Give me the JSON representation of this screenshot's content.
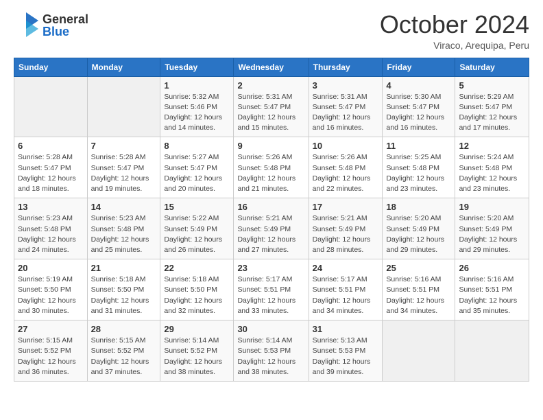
{
  "logo": {
    "general": "General",
    "blue": "Blue"
  },
  "header": {
    "month": "October 2024",
    "location": "Viraco, Arequipa, Peru"
  },
  "days_of_week": [
    "Sunday",
    "Monday",
    "Tuesday",
    "Wednesday",
    "Thursday",
    "Friday",
    "Saturday"
  ],
  "weeks": [
    [
      {
        "day": "",
        "empty": true
      },
      {
        "day": "",
        "empty": true
      },
      {
        "day": "1",
        "sunrise": "5:32 AM",
        "sunset": "5:46 PM",
        "daylight": "12 hours and 14 minutes."
      },
      {
        "day": "2",
        "sunrise": "5:31 AM",
        "sunset": "5:47 PM",
        "daylight": "12 hours and 15 minutes."
      },
      {
        "day": "3",
        "sunrise": "5:31 AM",
        "sunset": "5:47 PM",
        "daylight": "12 hours and 16 minutes."
      },
      {
        "day": "4",
        "sunrise": "5:30 AM",
        "sunset": "5:47 PM",
        "daylight": "12 hours and 16 minutes."
      },
      {
        "day": "5",
        "sunrise": "5:29 AM",
        "sunset": "5:47 PM",
        "daylight": "12 hours and 17 minutes."
      }
    ],
    [
      {
        "day": "6",
        "sunrise": "5:28 AM",
        "sunset": "5:47 PM",
        "daylight": "12 hours and 18 minutes."
      },
      {
        "day": "7",
        "sunrise": "5:28 AM",
        "sunset": "5:47 PM",
        "daylight": "12 hours and 19 minutes."
      },
      {
        "day": "8",
        "sunrise": "5:27 AM",
        "sunset": "5:47 PM",
        "daylight": "12 hours and 20 minutes."
      },
      {
        "day": "9",
        "sunrise": "5:26 AM",
        "sunset": "5:48 PM",
        "daylight": "12 hours and 21 minutes."
      },
      {
        "day": "10",
        "sunrise": "5:26 AM",
        "sunset": "5:48 PM",
        "daylight": "12 hours and 22 minutes."
      },
      {
        "day": "11",
        "sunrise": "5:25 AM",
        "sunset": "5:48 PM",
        "daylight": "12 hours and 23 minutes."
      },
      {
        "day": "12",
        "sunrise": "5:24 AM",
        "sunset": "5:48 PM",
        "daylight": "12 hours and 23 minutes."
      }
    ],
    [
      {
        "day": "13",
        "sunrise": "5:23 AM",
        "sunset": "5:48 PM",
        "daylight": "12 hours and 24 minutes."
      },
      {
        "day": "14",
        "sunrise": "5:23 AM",
        "sunset": "5:48 PM",
        "daylight": "12 hours and 25 minutes."
      },
      {
        "day": "15",
        "sunrise": "5:22 AM",
        "sunset": "5:49 PM",
        "daylight": "12 hours and 26 minutes."
      },
      {
        "day": "16",
        "sunrise": "5:21 AM",
        "sunset": "5:49 PM",
        "daylight": "12 hours and 27 minutes."
      },
      {
        "day": "17",
        "sunrise": "5:21 AM",
        "sunset": "5:49 PM",
        "daylight": "12 hours and 28 minutes."
      },
      {
        "day": "18",
        "sunrise": "5:20 AM",
        "sunset": "5:49 PM",
        "daylight": "12 hours and 29 minutes."
      },
      {
        "day": "19",
        "sunrise": "5:20 AM",
        "sunset": "5:49 PM",
        "daylight": "12 hours and 29 minutes."
      }
    ],
    [
      {
        "day": "20",
        "sunrise": "5:19 AM",
        "sunset": "5:50 PM",
        "daylight": "12 hours and 30 minutes."
      },
      {
        "day": "21",
        "sunrise": "5:18 AM",
        "sunset": "5:50 PM",
        "daylight": "12 hours and 31 minutes."
      },
      {
        "day": "22",
        "sunrise": "5:18 AM",
        "sunset": "5:50 PM",
        "daylight": "12 hours and 32 minutes."
      },
      {
        "day": "23",
        "sunrise": "5:17 AM",
        "sunset": "5:51 PM",
        "daylight": "12 hours and 33 minutes."
      },
      {
        "day": "24",
        "sunrise": "5:17 AM",
        "sunset": "5:51 PM",
        "daylight": "12 hours and 34 minutes."
      },
      {
        "day": "25",
        "sunrise": "5:16 AM",
        "sunset": "5:51 PM",
        "daylight": "12 hours and 34 minutes."
      },
      {
        "day": "26",
        "sunrise": "5:16 AM",
        "sunset": "5:51 PM",
        "daylight": "12 hours and 35 minutes."
      }
    ],
    [
      {
        "day": "27",
        "sunrise": "5:15 AM",
        "sunset": "5:52 PM",
        "daylight": "12 hours and 36 minutes."
      },
      {
        "day": "28",
        "sunrise": "5:15 AM",
        "sunset": "5:52 PM",
        "daylight": "12 hours and 37 minutes."
      },
      {
        "day": "29",
        "sunrise": "5:14 AM",
        "sunset": "5:52 PM",
        "daylight": "12 hours and 38 minutes."
      },
      {
        "day": "30",
        "sunrise": "5:14 AM",
        "sunset": "5:53 PM",
        "daylight": "12 hours and 38 minutes."
      },
      {
        "day": "31",
        "sunrise": "5:13 AM",
        "sunset": "5:53 PM",
        "daylight": "12 hours and 39 minutes."
      },
      {
        "day": "",
        "empty": true
      },
      {
        "day": "",
        "empty": true
      }
    ]
  ],
  "labels": {
    "sunrise": "Sunrise:",
    "sunset": "Sunset:",
    "daylight": "Daylight:"
  }
}
